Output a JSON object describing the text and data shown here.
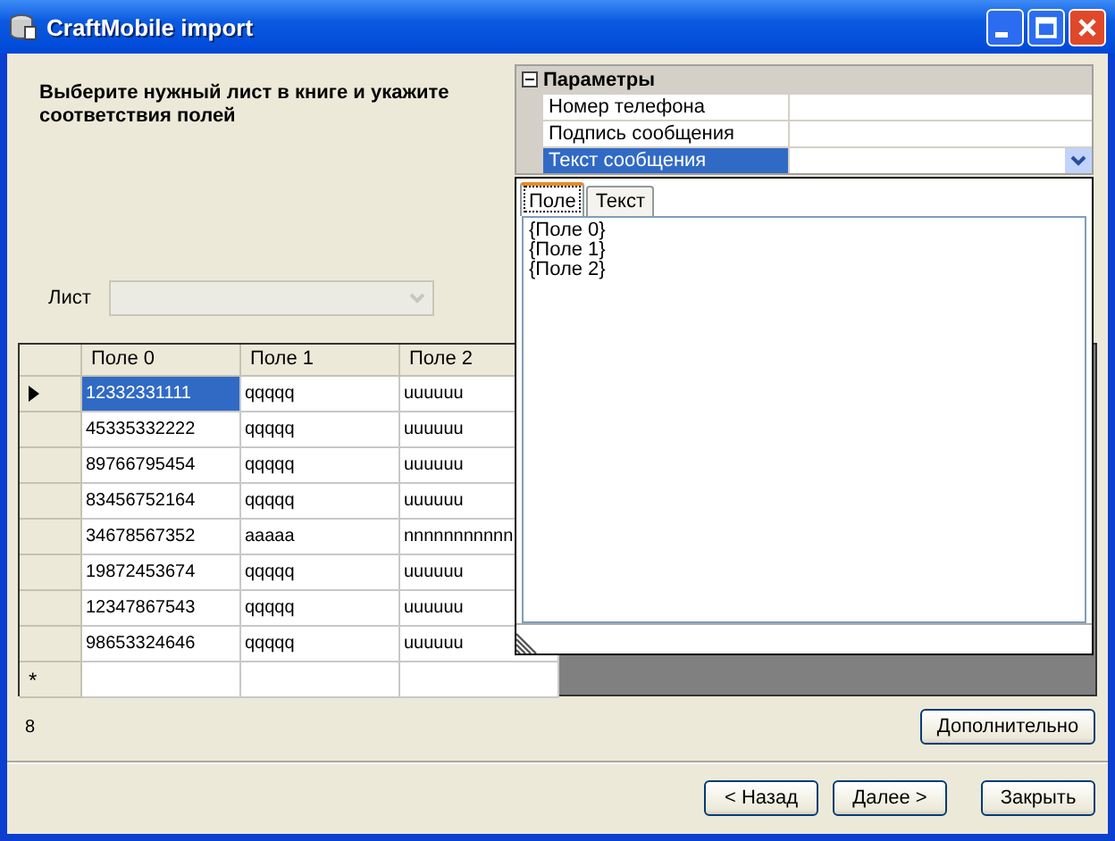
{
  "window": {
    "title": "CraftMobile import"
  },
  "instructions": "Выберите нужный лист в книге и укажите соответствия полей",
  "properties": {
    "header": "Параметры",
    "expanded": true,
    "rows": [
      {
        "label": "Номер телефона",
        "selected": false
      },
      {
        "label": "Подпись сообщения",
        "selected": false
      },
      {
        "label": "Текст сообщения",
        "selected": true
      }
    ]
  },
  "dropdown": {
    "tabs": [
      {
        "label": "Поле",
        "selected": true
      },
      {
        "label": "Текст",
        "selected": false
      }
    ],
    "items": [
      "{Поле 0}",
      "{Поле 1}",
      "{Поле 2}"
    ]
  },
  "sheet": {
    "label": "Лист",
    "disabled": true
  },
  "grid": {
    "columns": [
      "Поле 0",
      "Поле 1",
      "Поле 2"
    ],
    "rows": [
      {
        "cells": [
          "12332331111",
          "qqqqq",
          "uuuuuu"
        ],
        "current": true
      },
      {
        "cells": [
          "45335332222",
          "qqqqq",
          "uuuuuu"
        ],
        "current": false
      },
      {
        "cells": [
          "89766795454",
          "qqqqq",
          "uuuuuu"
        ],
        "current": false
      },
      {
        "cells": [
          "83456752164",
          "qqqqq",
          "uuuuuu"
        ],
        "current": false
      },
      {
        "cells": [
          "34678567352",
          "aaaaa",
          "nnnnnnnnnnn"
        ],
        "current": false
      },
      {
        "cells": [
          "19872453674",
          "qqqqq",
          "uuuuuu"
        ],
        "current": false
      },
      {
        "cells": [
          "12347867543",
          "qqqqq",
          "uuuuuu"
        ],
        "current": false
      },
      {
        "cells": [
          "98653324646",
          "qqqqq",
          "uuuuuu"
        ],
        "current": false
      }
    ],
    "new_row_marker": "*"
  },
  "record_count": "8",
  "more_button": "Дополнительно",
  "buttons": [
    "< Назад",
    "Далее >",
    "Закрыть"
  ]
}
